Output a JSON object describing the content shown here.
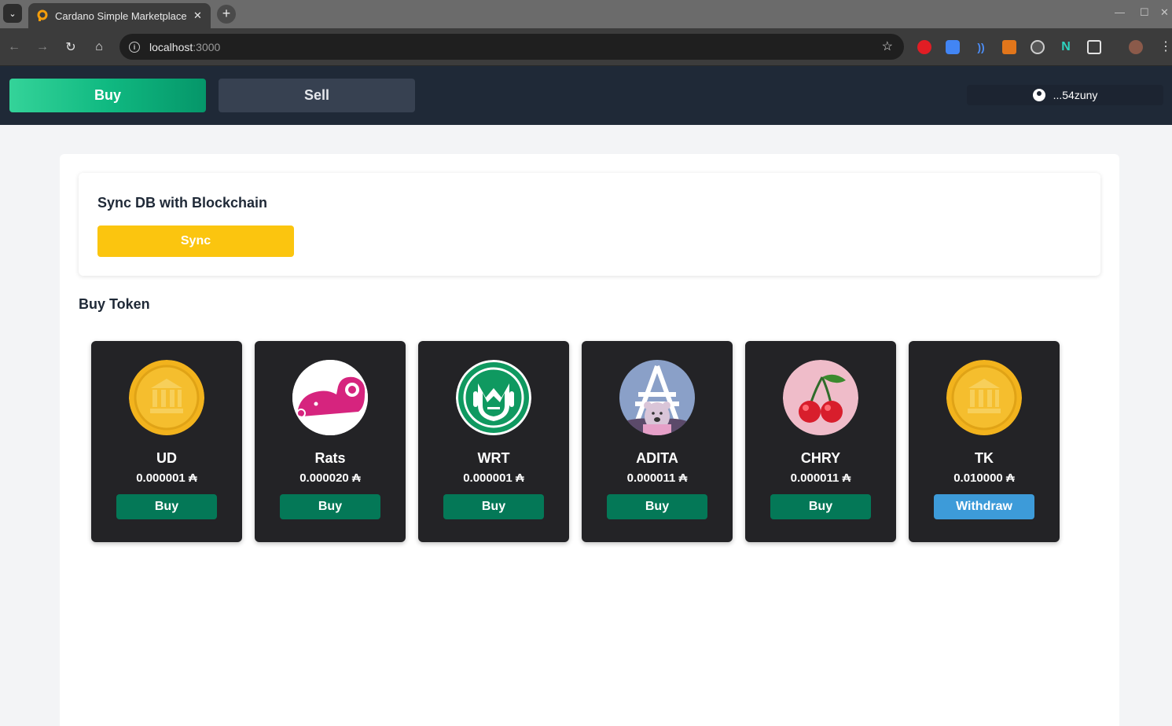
{
  "browser": {
    "tab_title": "Cardano Simple Marketplace",
    "tab_close": "✕",
    "new_tab": "+",
    "url_host": "localhost",
    "url_port": ":3000"
  },
  "header": {
    "buy_label": "Buy",
    "sell_label": "Sell",
    "wallet_address": "...54zuny"
  },
  "sync": {
    "title": "Sync DB with Blockchain",
    "button_label": "Sync"
  },
  "tokens_section": {
    "title": "Buy Token",
    "tokens": [
      {
        "name": "UD",
        "price": "0.000001 ₳",
        "action": "Buy",
        "icon": "gold-coin-icon"
      },
      {
        "name": "Rats",
        "price": "0.000020 ₳",
        "action": "Buy",
        "icon": "rat-icon"
      },
      {
        "name": "WRT",
        "price": "0.000001 ₳",
        "action": "Buy",
        "icon": "wrt-logo-icon"
      },
      {
        "name": "ADITA",
        "price": "0.000011 ₳",
        "action": "Buy",
        "icon": "adita-bear-icon"
      },
      {
        "name": "CHRY",
        "price": "0.000011 ₳",
        "action": "Buy",
        "icon": "cherry-icon"
      },
      {
        "name": "TK",
        "price": "0.010000 ₳",
        "action": "Withdraw",
        "icon": "gold-coin-icon"
      }
    ]
  },
  "colors": {
    "header_bg": "#1f2937",
    "buy_green": "#047857",
    "withdraw_blue": "#3d9bd9",
    "sync_yellow": "#fbc50f",
    "card_bg": "#232326"
  }
}
